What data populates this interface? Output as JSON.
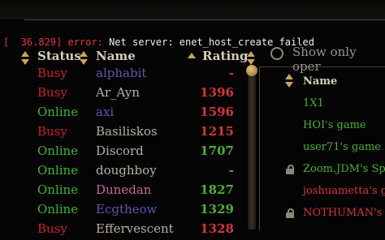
{
  "console": {
    "prefix_open": "[",
    "time": "  36.829]",
    "level": " error:",
    "message": " Net server: enet_host_create failed"
  },
  "left_table": {
    "headers": {
      "status": "Status",
      "name": "Name",
      "rating": "Rating"
    },
    "rows": [
      {
        "status": "Busy",
        "name": "alphabit",
        "rating": "-",
        "status_color": "#c2262c",
        "name_color": "#5a59b0",
        "rating_color": "#d0383a"
      },
      {
        "status": "Busy",
        "name": "Ar_Ayn",
        "rating": "1396",
        "status_color": "#c2262c",
        "name_color": "#b8b0a0",
        "rating_color": "#d0383a"
      },
      {
        "status": "Online",
        "name": "axi",
        "rating": "1596",
        "status_color": "#43b23a",
        "name_color": "#5a59b0",
        "rating_color": "#d0383a"
      },
      {
        "status": "Busy",
        "name": "Basiliskos",
        "rating": "1215",
        "status_color": "#c2262c",
        "name_color": "#b8b0a0",
        "rating_color": "#d0383a"
      },
      {
        "status": "Online",
        "name": "Discord",
        "rating": "1707",
        "status_color": "#43b23a",
        "name_color": "#b8b0a0",
        "rating_color": "#4caf39"
      },
      {
        "status": "Online",
        "name": "doughboy",
        "rating": "-",
        "status_color": "#43b23a",
        "name_color": "#b8b0a0",
        "rating_color": "#4caf39"
      },
      {
        "status": "Online",
        "name": "Dunedan",
        "rating": "1827",
        "status_color": "#43b23a",
        "name_color": "#c06aa0",
        "rating_color": "#4caf39"
      },
      {
        "status": "Online",
        "name": "Ecgtheow",
        "rating": "1329",
        "status_color": "#43b23a",
        "name_color": "#5a59b0",
        "rating_color": "#4caf39"
      },
      {
        "status": "Busy",
        "name": "Effervescent",
        "rating": "1328",
        "status_color": "#c2262c",
        "name_color": "#b8b0a0",
        "rating_color": "#d0383a"
      }
    ]
  },
  "right_panel": {
    "show_label": "Show only oper",
    "header_name": "Name",
    "games": [
      {
        "name": "1X1",
        "locked": false,
        "color": "#4caf39"
      },
      {
        "name": "HOI's game",
        "locked": false,
        "color": "#4caf39"
      },
      {
        "name": "user71's game",
        "locked": false,
        "color": "#4caf39"
      },
      {
        "name": "Zoom.JDM's Sp",
        "locked": true,
        "color": "#4caf39"
      },
      {
        "name": "joshuametta's g",
        "locked": false,
        "color": "#d0383a"
      },
      {
        "name": "NOTHUMAN's g",
        "locked": true,
        "color": "#d0383a"
      }
    ]
  },
  "colors": {
    "busy": "#c2262c",
    "online": "#43b23a",
    "accent_gold": "#c7a35b",
    "rating_red": "#d0383a",
    "rating_green": "#4caf39"
  }
}
